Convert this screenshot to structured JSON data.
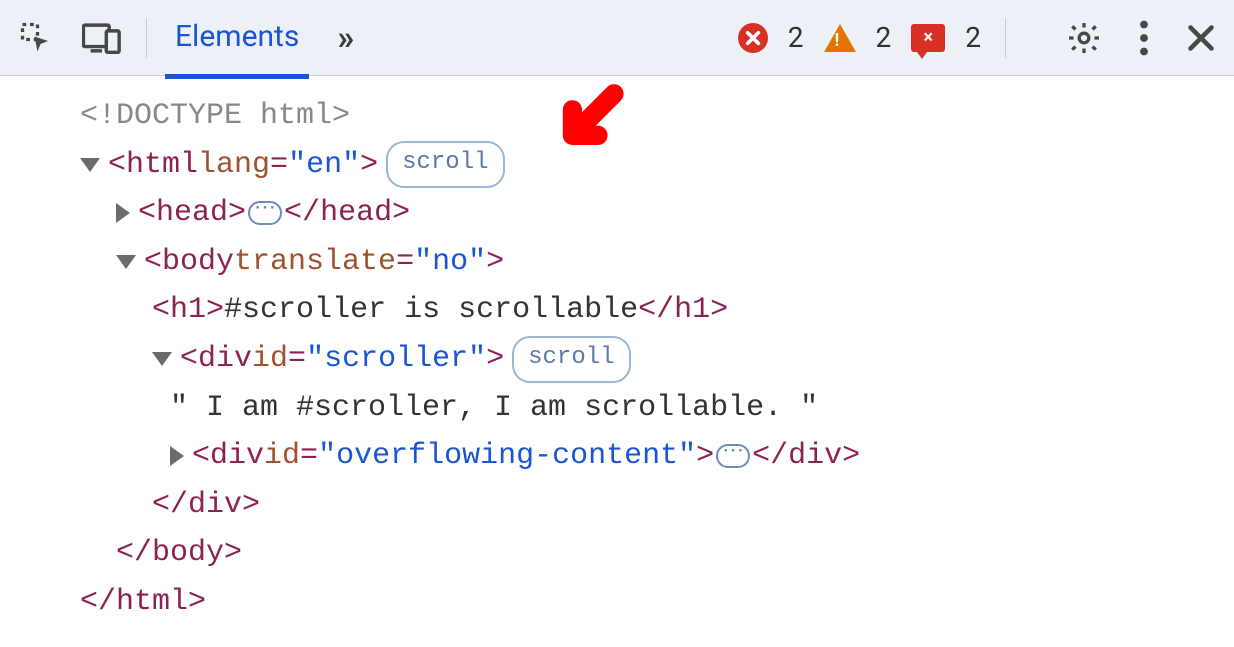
{
  "toolbar": {
    "tabs": {
      "elements": "Elements"
    },
    "counts": {
      "errors": "2",
      "warnings": "2",
      "messages": "2"
    }
  },
  "dom": {
    "doctype": "<!DOCTYPE html>",
    "html_open": {
      "tag": "html",
      "attr": "lang",
      "val": "\"en\""
    },
    "head_open": "head",
    "head_close": "head",
    "body_open": {
      "tag": "body",
      "attr": "translate",
      "val": "\"no\""
    },
    "h1": {
      "tag": "h1",
      "text": "#scroller is scrollable"
    },
    "div_scroller": {
      "tag": "div",
      "attr": "id",
      "val": "\"scroller\""
    },
    "text_node": "\" I am #scroller, I am scrollable. \"",
    "div_overflow": {
      "tag": "div",
      "attr": "id",
      "val": "\"overflowing-content\""
    },
    "div_close": "div",
    "body_close": "body",
    "html_close": "html",
    "badge_scroll": "scroll"
  }
}
